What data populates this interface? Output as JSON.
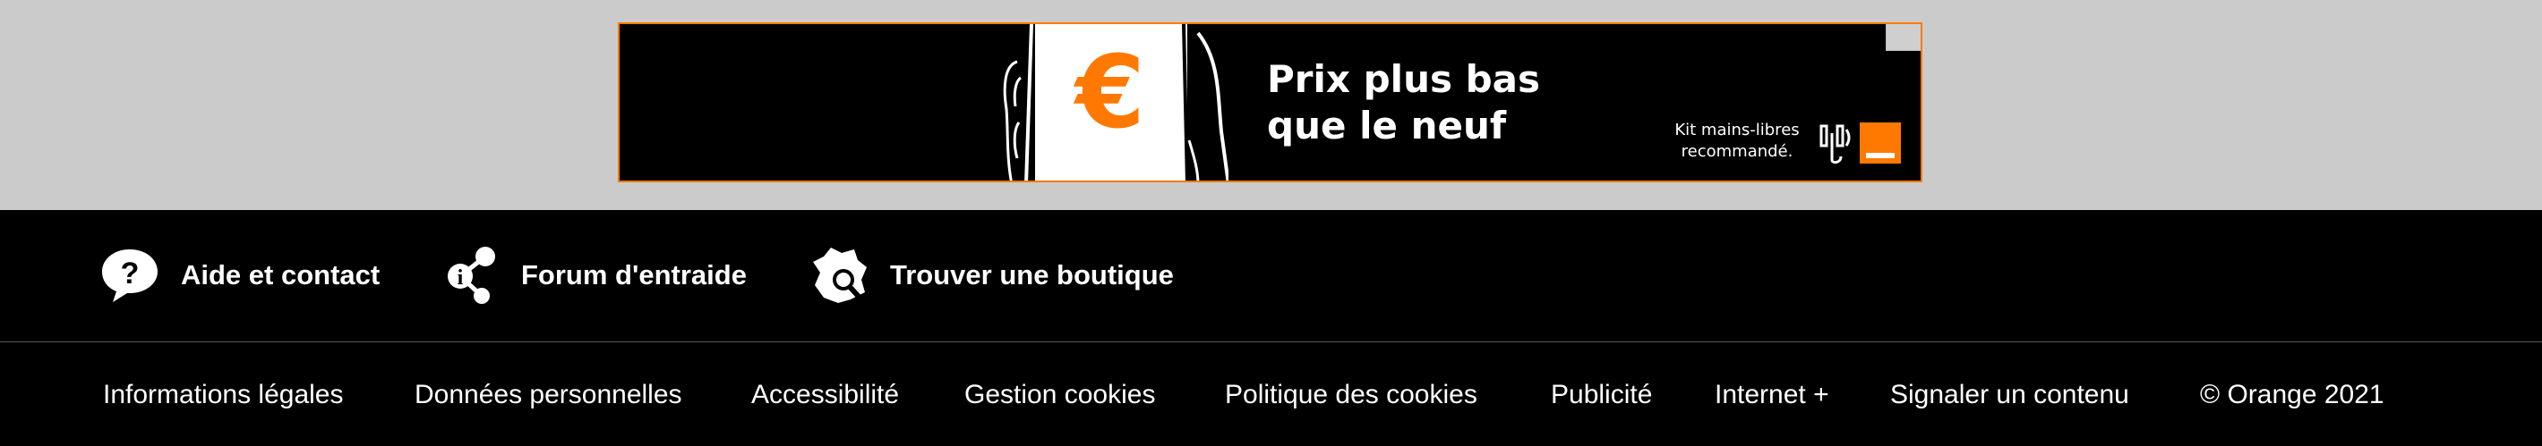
{
  "ad": {
    "headline_line1": "Prix plus bas",
    "headline_line2": "que le neuf",
    "legal_line1": "Kit mains-libres",
    "legal_line2": "recommandé.",
    "currency_symbol": "€",
    "accent_color": "#ff7900"
  },
  "footer": {
    "quick_links": [
      {
        "label": "Aide et contact",
        "icon": "question-bubble-icon"
      },
      {
        "label": "Forum d'entraide",
        "icon": "share-info-icon"
      },
      {
        "label": "Trouver une boutique",
        "icon": "france-map-search-icon"
      }
    ],
    "legal_links": [
      {
        "label": "Informations légales"
      },
      {
        "label": "Données personnelles"
      },
      {
        "label": "Accessibilité"
      },
      {
        "label": "Gestion cookies"
      },
      {
        "label": "Politique des cookies"
      },
      {
        "label": "Publicité"
      },
      {
        "label": "Internet +"
      },
      {
        "label": "Signaler un contenu"
      }
    ],
    "copyright": "© Orange 2021"
  }
}
